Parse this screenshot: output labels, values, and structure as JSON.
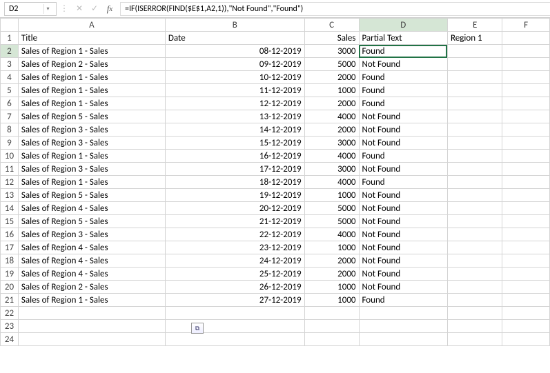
{
  "nameBox": "D2",
  "formula": "=IF(ISERROR(FIND($E$1,A2,1)),\"Not Found\",\"Found\")",
  "columns": [
    "A",
    "B",
    "C",
    "D",
    "E",
    "F"
  ],
  "headerRow": {
    "A": "Title",
    "B": "Date",
    "C": "Sales",
    "D": "Partial Text",
    "E": "Region 1"
  },
  "rows": [
    {
      "r": 2,
      "A": "Sales of Region 1 - Sales",
      "B": "08-12-2019",
      "C": "3000",
      "D": "Found"
    },
    {
      "r": 3,
      "A": "Sales of Region 2 - Sales",
      "B": "09-12-2019",
      "C": "5000",
      "D": "Not Found"
    },
    {
      "r": 4,
      "A": "Sales of Region 1 - Sales",
      "B": "10-12-2019",
      "C": "2000",
      "D": "Found"
    },
    {
      "r": 5,
      "A": "Sales of Region 1 - Sales",
      "B": "11-12-2019",
      "C": "1000",
      "D": "Found"
    },
    {
      "r": 6,
      "A": "Sales of Region 1 - Sales",
      "B": "12-12-2019",
      "C": "2000",
      "D": "Found"
    },
    {
      "r": 7,
      "A": "Sales of Region 5 - Sales",
      "B": "13-12-2019",
      "C": "4000",
      "D": "Not Found"
    },
    {
      "r": 8,
      "A": "Sales of Region 3 - Sales",
      "B": "14-12-2019",
      "C": "2000",
      "D": "Not Found"
    },
    {
      "r": 9,
      "A": "Sales of Region 3 - Sales",
      "B": "15-12-2019",
      "C": "3000",
      "D": "Not Found"
    },
    {
      "r": 10,
      "A": "Sales of Region 1 - Sales",
      "B": "16-12-2019",
      "C": "4000",
      "D": "Found"
    },
    {
      "r": 11,
      "A": "Sales of Region 3 - Sales",
      "B": "17-12-2019",
      "C": "3000",
      "D": "Not Found"
    },
    {
      "r": 12,
      "A": "Sales of Region 1 - Sales",
      "B": "18-12-2019",
      "C": "4000",
      "D": "Found"
    },
    {
      "r": 13,
      "A": "Sales of Region 5 - Sales",
      "B": "19-12-2019",
      "C": "1000",
      "D": "Not Found"
    },
    {
      "r": 14,
      "A": "Sales of Region 4 - Sales",
      "B": "20-12-2019",
      "C": "5000",
      "D": "Not Found"
    },
    {
      "r": 15,
      "A": "Sales of Region 5 - Sales",
      "B": "21-12-2019",
      "C": "5000",
      "D": "Not Found"
    },
    {
      "r": 16,
      "A": "Sales of Region 3 - Sales",
      "B": "22-12-2019",
      "C": "4000",
      "D": "Not Found"
    },
    {
      "r": 17,
      "A": "Sales of Region 4 - Sales",
      "B": "23-12-2019",
      "C": "1000",
      "D": "Not Found"
    },
    {
      "r": 18,
      "A": "Sales of Region 4 - Sales",
      "B": "24-12-2019",
      "C": "2000",
      "D": "Not Found"
    },
    {
      "r": 19,
      "A": "Sales of Region 4 - Sales",
      "B": "25-12-2019",
      "C": "2000",
      "D": "Not Found"
    },
    {
      "r": 20,
      "A": "Sales of Region 2 - Sales",
      "B": "26-12-2019",
      "C": "1000",
      "D": "Not Found"
    },
    {
      "r": 21,
      "A": "Sales of Region 1 - Sales",
      "B": "27-12-2019",
      "C": "1000",
      "D": "Found"
    }
  ],
  "emptyRows": [
    22,
    23,
    24
  ],
  "activeCell": {
    "row": 2,
    "col": "D"
  },
  "pasteIcon": "⧉"
}
